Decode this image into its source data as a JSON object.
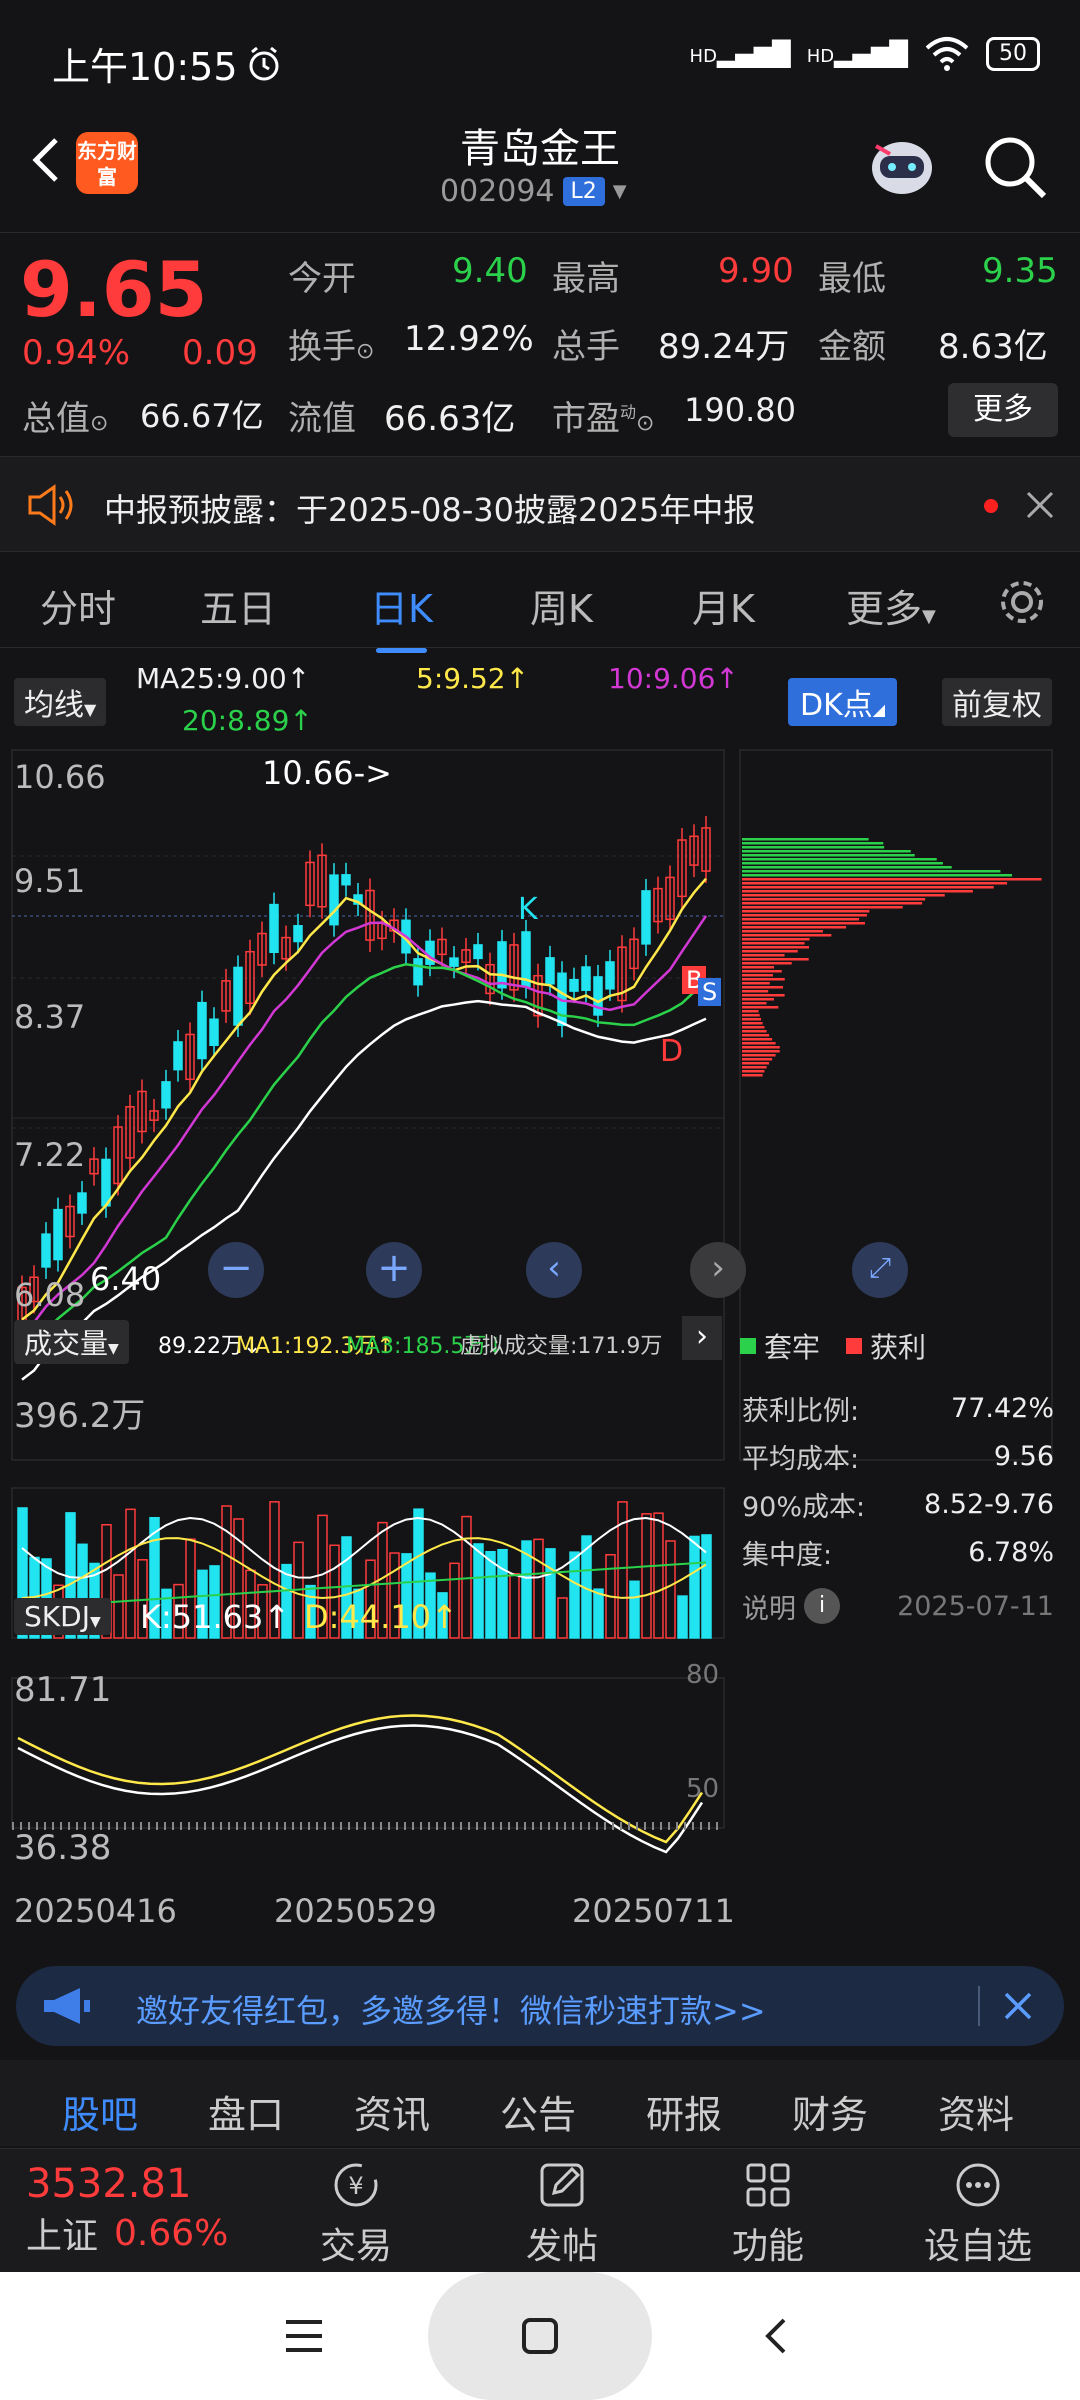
{
  "status": {
    "time": "上午10:55",
    "signal1": "HD",
    "signal2": "HD",
    "battery": "50"
  },
  "header": {
    "logo": "东方财富",
    "name": "青岛金王",
    "code": "002094",
    "badge": "L2"
  },
  "quote": {
    "price": "9.65",
    "chg_pct": "0.94%",
    "chg_abs": "0.09",
    "open_label": "今开",
    "open": "9.40",
    "high_label": "最高",
    "high": "9.90",
    "low_label": "最低",
    "low": "9.35",
    "turnover_label": "换手",
    "turnover": "12.92%",
    "volume_label": "总手",
    "volume": "89.24万",
    "amount_label": "金额",
    "amount": "8.63亿",
    "mktcap_label": "总值",
    "mktcap": "66.67亿",
    "float_label": "流值",
    "float": "66.63亿",
    "pe_label": "市盈",
    "pe_sup": "动",
    "pe": "190.80",
    "more": "更多"
  },
  "notice": {
    "text": "中报预披露：于2025-08-30披露2025年中报"
  },
  "period_tabs": [
    "分时",
    "五日",
    "日K",
    "周K",
    "月K",
    "更多"
  ],
  "ma_bar": {
    "selector": "均线",
    "ma25": "MA25:9.00↑",
    "ma5": "5:9.52↑",
    "ma10": "10:9.06↑",
    "ma20": "20:8.89↑",
    "dk": "DK点",
    "adjust": "前复权"
  },
  "kline": {
    "y_labels": [
      "10.66",
      "9.51",
      "8.37",
      "7.22",
      "6.08"
    ],
    "max_note": "10.66->",
    "min_note": "6.40",
    "markers": {
      "k": "K",
      "d": "D",
      "b": "B",
      "s": "S"
    }
  },
  "volume_bar": {
    "selector": "成交量",
    "vol": "89.22万↓",
    "ma1": "MA1:192.3万↑",
    "ma3": "MA3:185.5万↓",
    "virtual": "虚拟成交量:171.9万",
    "y_label": "396.2万"
  },
  "skdj": {
    "selector": "SKDJ",
    "k": "K:51.63↑",
    "d": "D:44.10↑",
    "y_top": "81.71",
    "y_bottom": "36.38",
    "r80": "80",
    "r50": "50"
  },
  "dates": [
    "20250416",
    "20250529",
    "20250711"
  ],
  "chip": {
    "legend_trap": "套牢",
    "legend_profit": "获利",
    "rows": [
      {
        "label": "获利比例:",
        "value": "77.42%"
      },
      {
        "label": "平均成本:",
        "value": "9.56"
      },
      {
        "label": "90%成本:",
        "value": "8.52-9.76"
      },
      {
        "label": "集中度:",
        "value": "6.78%"
      }
    ],
    "note_label": "说明",
    "date": "2025-07-11"
  },
  "banner": {
    "text": "邀好友得红包，多邀多得！微信秒速打款>>"
  },
  "info_tabs": [
    "股吧",
    "盘口",
    "资讯",
    "公告",
    "研报",
    "财务",
    "资料"
  ],
  "bottom": {
    "index_value": "3532.81",
    "index_name": "上证",
    "index_pct": "0.66%",
    "trade": "交易",
    "post": "发帖",
    "func": "功能",
    "watch": "设自选"
  },
  "colors": {
    "up": "#ff3b3b",
    "down": "#2bd14a",
    "accent": "#3f8cff",
    "cyan": "#22e3f0"
  }
}
